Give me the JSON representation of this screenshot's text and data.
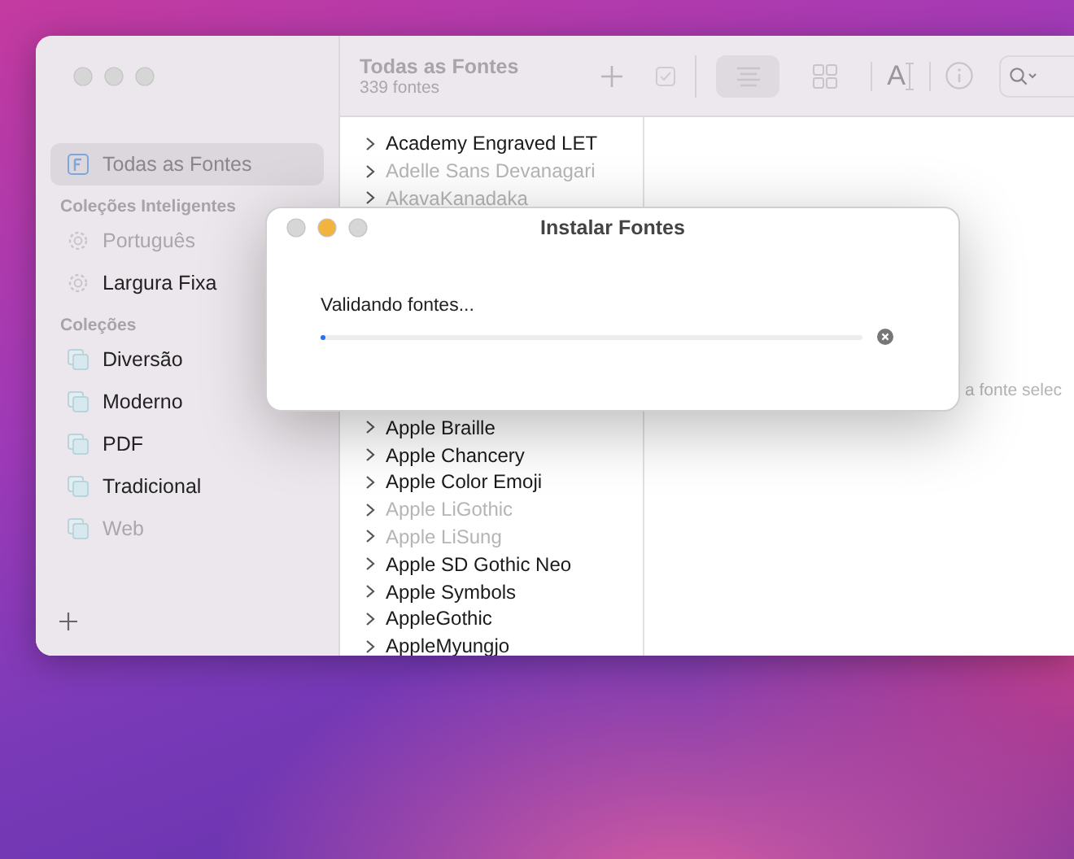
{
  "window": {
    "title": "Todas as Fontes",
    "subtitle": "339 fontes"
  },
  "sidebar": {
    "top_items": [
      {
        "kind": "all",
        "label": "Todas as Fontes",
        "selected": true,
        "disabled": false
      }
    ],
    "sections": [
      {
        "title": "Coleções Inteligentes",
        "items": [
          {
            "kind": "smart",
            "label": "Português",
            "selected": false,
            "disabled": true
          },
          {
            "kind": "smart",
            "label": "Largura Fixa",
            "selected": false,
            "disabled": false
          }
        ]
      },
      {
        "title": "Coleções",
        "items": [
          {
            "kind": "collection",
            "label": "Diversão",
            "selected": false,
            "disabled": false
          },
          {
            "kind": "collection",
            "label": "Moderno",
            "selected": false,
            "disabled": false
          },
          {
            "kind": "collection",
            "label": "PDF",
            "selected": false,
            "disabled": false
          },
          {
            "kind": "collection",
            "label": "Tradicional",
            "selected": false,
            "disabled": false
          },
          {
            "kind": "collection",
            "label": "Web",
            "selected": false,
            "disabled": true
          }
        ]
      }
    ]
  },
  "toolbar": {
    "view_buttons": [
      {
        "kind": "list",
        "selected": true
      },
      {
        "kind": "grid",
        "selected": false
      }
    ],
    "sample_label": "A"
  },
  "font_list": [
    {
      "name": "Academy Engraved LET",
      "disabled": false
    },
    {
      "name": "Adelle Sans Devanagari",
      "disabled": true
    },
    {
      "name": "AkavaKanadaka",
      "disabled": true
    },
    {
      "name": "Apple Braille",
      "disabled": false
    },
    {
      "name": "Apple Chancery",
      "disabled": false
    },
    {
      "name": "Apple Color Emoji",
      "disabled": false
    },
    {
      "name": "Apple LiGothic",
      "disabled": true
    },
    {
      "name": "Apple LiSung",
      "disabled": true
    },
    {
      "name": "Apple SD Gothic Neo",
      "disabled": false
    },
    {
      "name": "Apple Symbols",
      "disabled": false
    },
    {
      "name": "AppleGothic",
      "disabled": false
    },
    {
      "name": "AppleMyungjo",
      "disabled": false
    }
  ],
  "detail": {
    "message": "a fonte selec"
  },
  "dialog": {
    "title": "Instalar Fontes",
    "status": "Validando fontes...",
    "level": 0.01
  }
}
